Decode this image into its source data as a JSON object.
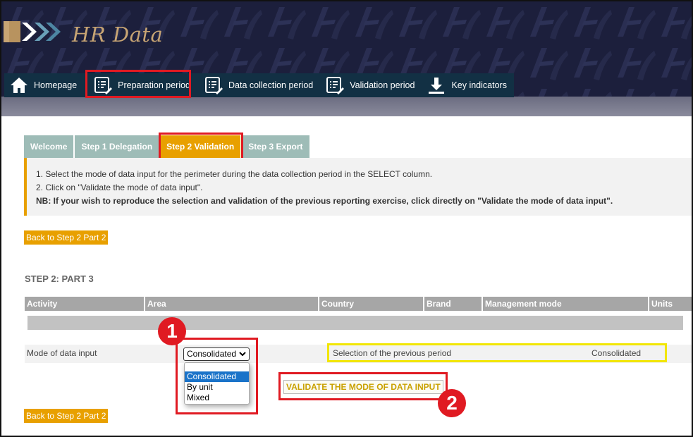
{
  "header": {
    "app_title": "HR Data",
    "colors": {
      "navy": "#1c1f3c",
      "gold": "#c8a574",
      "navbar": "#123044"
    }
  },
  "nav": [
    {
      "label": "Homepage",
      "icon": "home-icon"
    },
    {
      "label": "Preparation period",
      "icon": "checklist-edit-icon"
    },
    {
      "label": "Data collection period",
      "icon": "checklist-edit-icon"
    },
    {
      "label": "Validation period",
      "icon": "checklist-edit-icon"
    },
    {
      "label": "Key indicators",
      "icon": "download-icon"
    }
  ],
  "tabs": [
    {
      "label": "Welcome",
      "active": false
    },
    {
      "label": "Step 1 Delegation",
      "active": false
    },
    {
      "label": "Step 2 Validation",
      "active": true
    },
    {
      "label": "Step 3 Export",
      "active": false
    }
  ],
  "info": {
    "line1": "1. Select the mode of data input for the perimeter during the data collection period in the SELECT column.",
    "line2": "2. Click on \"Validate the mode of data input\".",
    "note": "NB: If your wish to reproduce the selection and validation of the previous reporting exercise, click directly on \"Validate the mode of data input\"."
  },
  "back_button": "Back to Step 2 Part 2",
  "section_title": "STEP 2: PART 3",
  "table": {
    "headers": [
      "Activity",
      "Area",
      "Country",
      "Brand",
      "Management mode",
      "Units"
    ]
  },
  "row": {
    "label": "Mode of data input",
    "select_value": "Consolidated",
    "options": [
      "Consolidated",
      "By unit",
      "Mixed"
    ],
    "selected_option": "Consolidated",
    "previous_label": "Selection of the previous period",
    "previous_value": "Consolidated"
  },
  "validate_button": "VALIDATE THE MODE OF DATA INPUT",
  "annotations": {
    "badge1": "1",
    "badge2": "2",
    "red": "#e01a22",
    "yellow": "#f2e600"
  }
}
